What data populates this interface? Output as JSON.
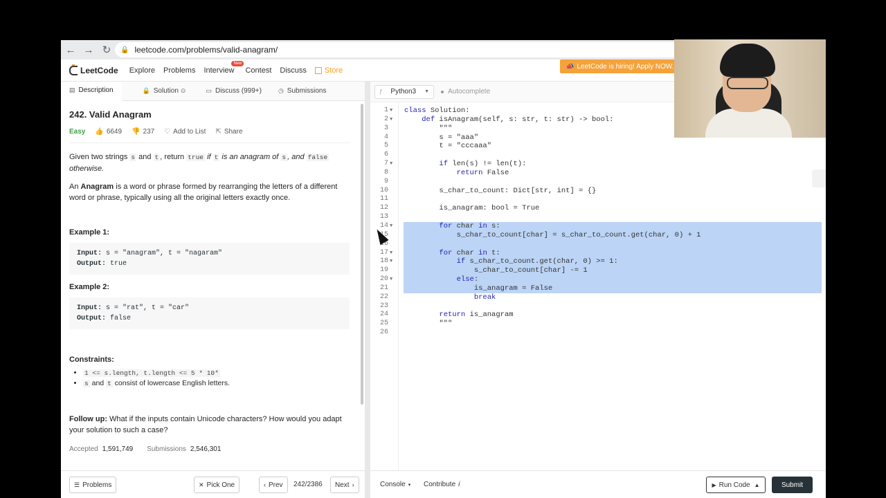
{
  "browser": {
    "url": "leetcode.com/problems/valid-anagram/"
  },
  "nav": {
    "logo": "LeetCode",
    "links": [
      "Explore",
      "Problems",
      "Interview",
      "Contest",
      "Discuss",
      "Store"
    ],
    "new_badge": "New",
    "hiring": "LeetCode is hiring! Apply NOW."
  },
  "tabs": [
    "Description",
    "Solution",
    "Discuss (999+)",
    "Submissions"
  ],
  "problem": {
    "title": "242. Valid Anagram",
    "difficulty": "Easy",
    "likes": "6649",
    "dislikes": "237",
    "add_to_list": "Add to List",
    "share": "Share",
    "statement_1a": "Given two strings ",
    "statement_s": "s",
    "statement_1b": " and ",
    "statement_t": "t",
    "statement_1c": ", return ",
    "statement_true": "true",
    "statement_1d": " if ",
    "statement_t2": "t",
    "statement_1e": " is an anagram of ",
    "statement_s2": "s",
    "statement_1f": ", and ",
    "statement_false": "false",
    "statement_1g": "otherwise.",
    "anagram_def_a": "An ",
    "anagram_def_b": "Anagram",
    "anagram_def_c": " is a word or phrase formed by rearranging the letters of a different word or phrase, typically using all the original letters exactly once.",
    "example1_title": "Example 1:",
    "example1_input_label": "Input:",
    "example1_input": " s = \"anagram\", t = \"nagaram\"",
    "example1_output_label": "Output:",
    "example1_output": " true",
    "example2_title": "Example 2:",
    "example2_input_label": "Input:",
    "example2_input": " s = \"rat\", t = \"car\"",
    "example2_output_label": "Output:",
    "example2_output": " false",
    "constraints_title": "Constraints:",
    "constraint1": "1 <= s.length, t.length <= 5 * 10⁴",
    "constraint2_s": "s",
    "constraint2_and": " and ",
    "constraint2_t": "t",
    "constraint2_rest": " consist of lowercase English letters.",
    "followup_label": "Follow up:",
    "followup_text": " What if the inputs contain Unicode characters? How would you adapt your solution to such a case?",
    "accepted_label": "Accepted",
    "accepted_value": "1,591,749",
    "submissions_label": "Submissions",
    "submissions_value": "2,546,301"
  },
  "left_footer": {
    "problems": "Problems",
    "pick_one": "Pick One",
    "prev": "Prev",
    "page": "242/2386",
    "next": "Next"
  },
  "editor": {
    "language": "Python3",
    "autocomplete": "Autocomplete",
    "lines": [
      "class Solution:",
      "    def isAnagram(self, s: str, t: str) -> bool:",
      "        \"\"\"",
      "        s = \"aaa\"",
      "        t = \"cccaaa\"",
      "",
      "        if len(s) != len(t):",
      "            return False",
      "",
      "        s_char_to_count: Dict[str, int] = {}",
      "",
      "        is_anagram: bool = True",
      "",
      "        for char in s:",
      "            s_char_to_count[char] = s_char_to_count.get(char, 0) + 1",
      "",
      "        for char in t:",
      "            if s_char_to_count.get(char, 0) >= 1:",
      "                s_char_to_count[char] -= 1",
      "            else:",
      "                is_anagram = False",
      "                break",
      "",
      "        return is_anagram",
      "        \"\"\"",
      ""
    ],
    "fold_lines": [
      1,
      2,
      7,
      14,
      17,
      18,
      20
    ],
    "selected_from": 14,
    "selected_to": 22
  },
  "editor_footer": {
    "console": "Console",
    "contribute": "Contribute",
    "run": "Run Code",
    "submit": "Submit"
  },
  "colors": {
    "accent": "#f89f1b",
    "easy": "#43a047",
    "selection": "#bcd4f5",
    "submit_bg": "#263238"
  }
}
